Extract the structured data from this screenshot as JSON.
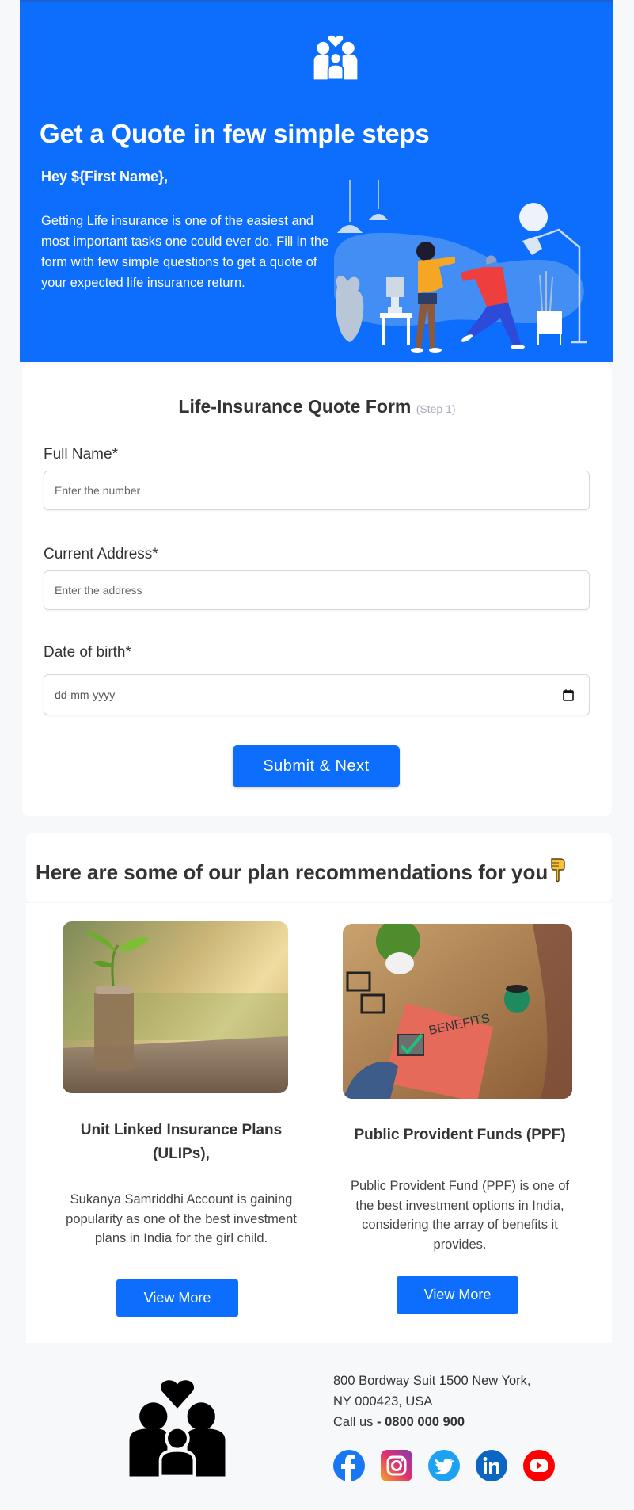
{
  "colors": {
    "primary": "#0d6efd",
    "page_bg": "#f7f8fa",
    "text": "#333333"
  },
  "hero": {
    "logo_icon": "family-heart-icon",
    "title": "Get a Quote in few simple steps",
    "greeting": "Hey ${First Name},",
    "text": "Getting Life insurance is one of the easiest and most important tasks one could ever do. Fill in the form with few simple questions to get a quote of your expected life insurance return.",
    "illustration": "people-greeting-illustration"
  },
  "form": {
    "title": "Life-Insurance Quote Form",
    "step": "(Step 1)",
    "fields": [
      {
        "label": "Full Name*",
        "placeholder": "Enter the number",
        "value": ""
      },
      {
        "label": "Current Address*",
        "placeholder": "Enter the address",
        "value": ""
      },
      {
        "label": "Date of birth*",
        "placeholder": "dd-mm-yyyy",
        "value": ""
      }
    ],
    "calendar_icon": "calendar-icon",
    "submit_label": "Submit & Next"
  },
  "recommendations": {
    "title": "Here are some of our plan recommendations for you",
    "title_icon": "backhand-pointing-down-icon",
    "cards": [
      {
        "image": "plant-in-coin-jar-photo",
        "title": "Unit Linked Insurance Plans (ULIPs),",
        "description": "Sukanya Samriddhi Account is gaining popularity as one of the best investment plans in India for the girl child.",
        "button": "View More"
      },
      {
        "image": "benefits-paper-on-desk-photo",
        "title": "Public Provident Funds (PPF)",
        "description": "Public Provident Fund (PPF) is one of the best investment options in India, considering the array of benefits it provides.",
        "button": "View More"
      }
    ]
  },
  "footer": {
    "logo_icon": "family-heart-icon",
    "address_line1": "800 Bordway Suit 1500 New York,",
    "address_line2": "NY 000423, USA",
    "call_label": "Call us",
    "call_sep": " - ",
    "phone": "0800 000 900",
    "socials": [
      {
        "name": "facebook",
        "icon": "facebook-icon",
        "color": "#1877f2"
      },
      {
        "name": "instagram",
        "icon": "instagram-icon",
        "color": "#d6249f"
      },
      {
        "name": "twitter",
        "icon": "twitter-icon",
        "color": "#1da1f2"
      },
      {
        "name": "linkedin",
        "icon": "linkedin-icon",
        "color": "#0a66c2"
      },
      {
        "name": "youtube",
        "icon": "youtube-icon",
        "color": "#ff0000"
      }
    ]
  }
}
